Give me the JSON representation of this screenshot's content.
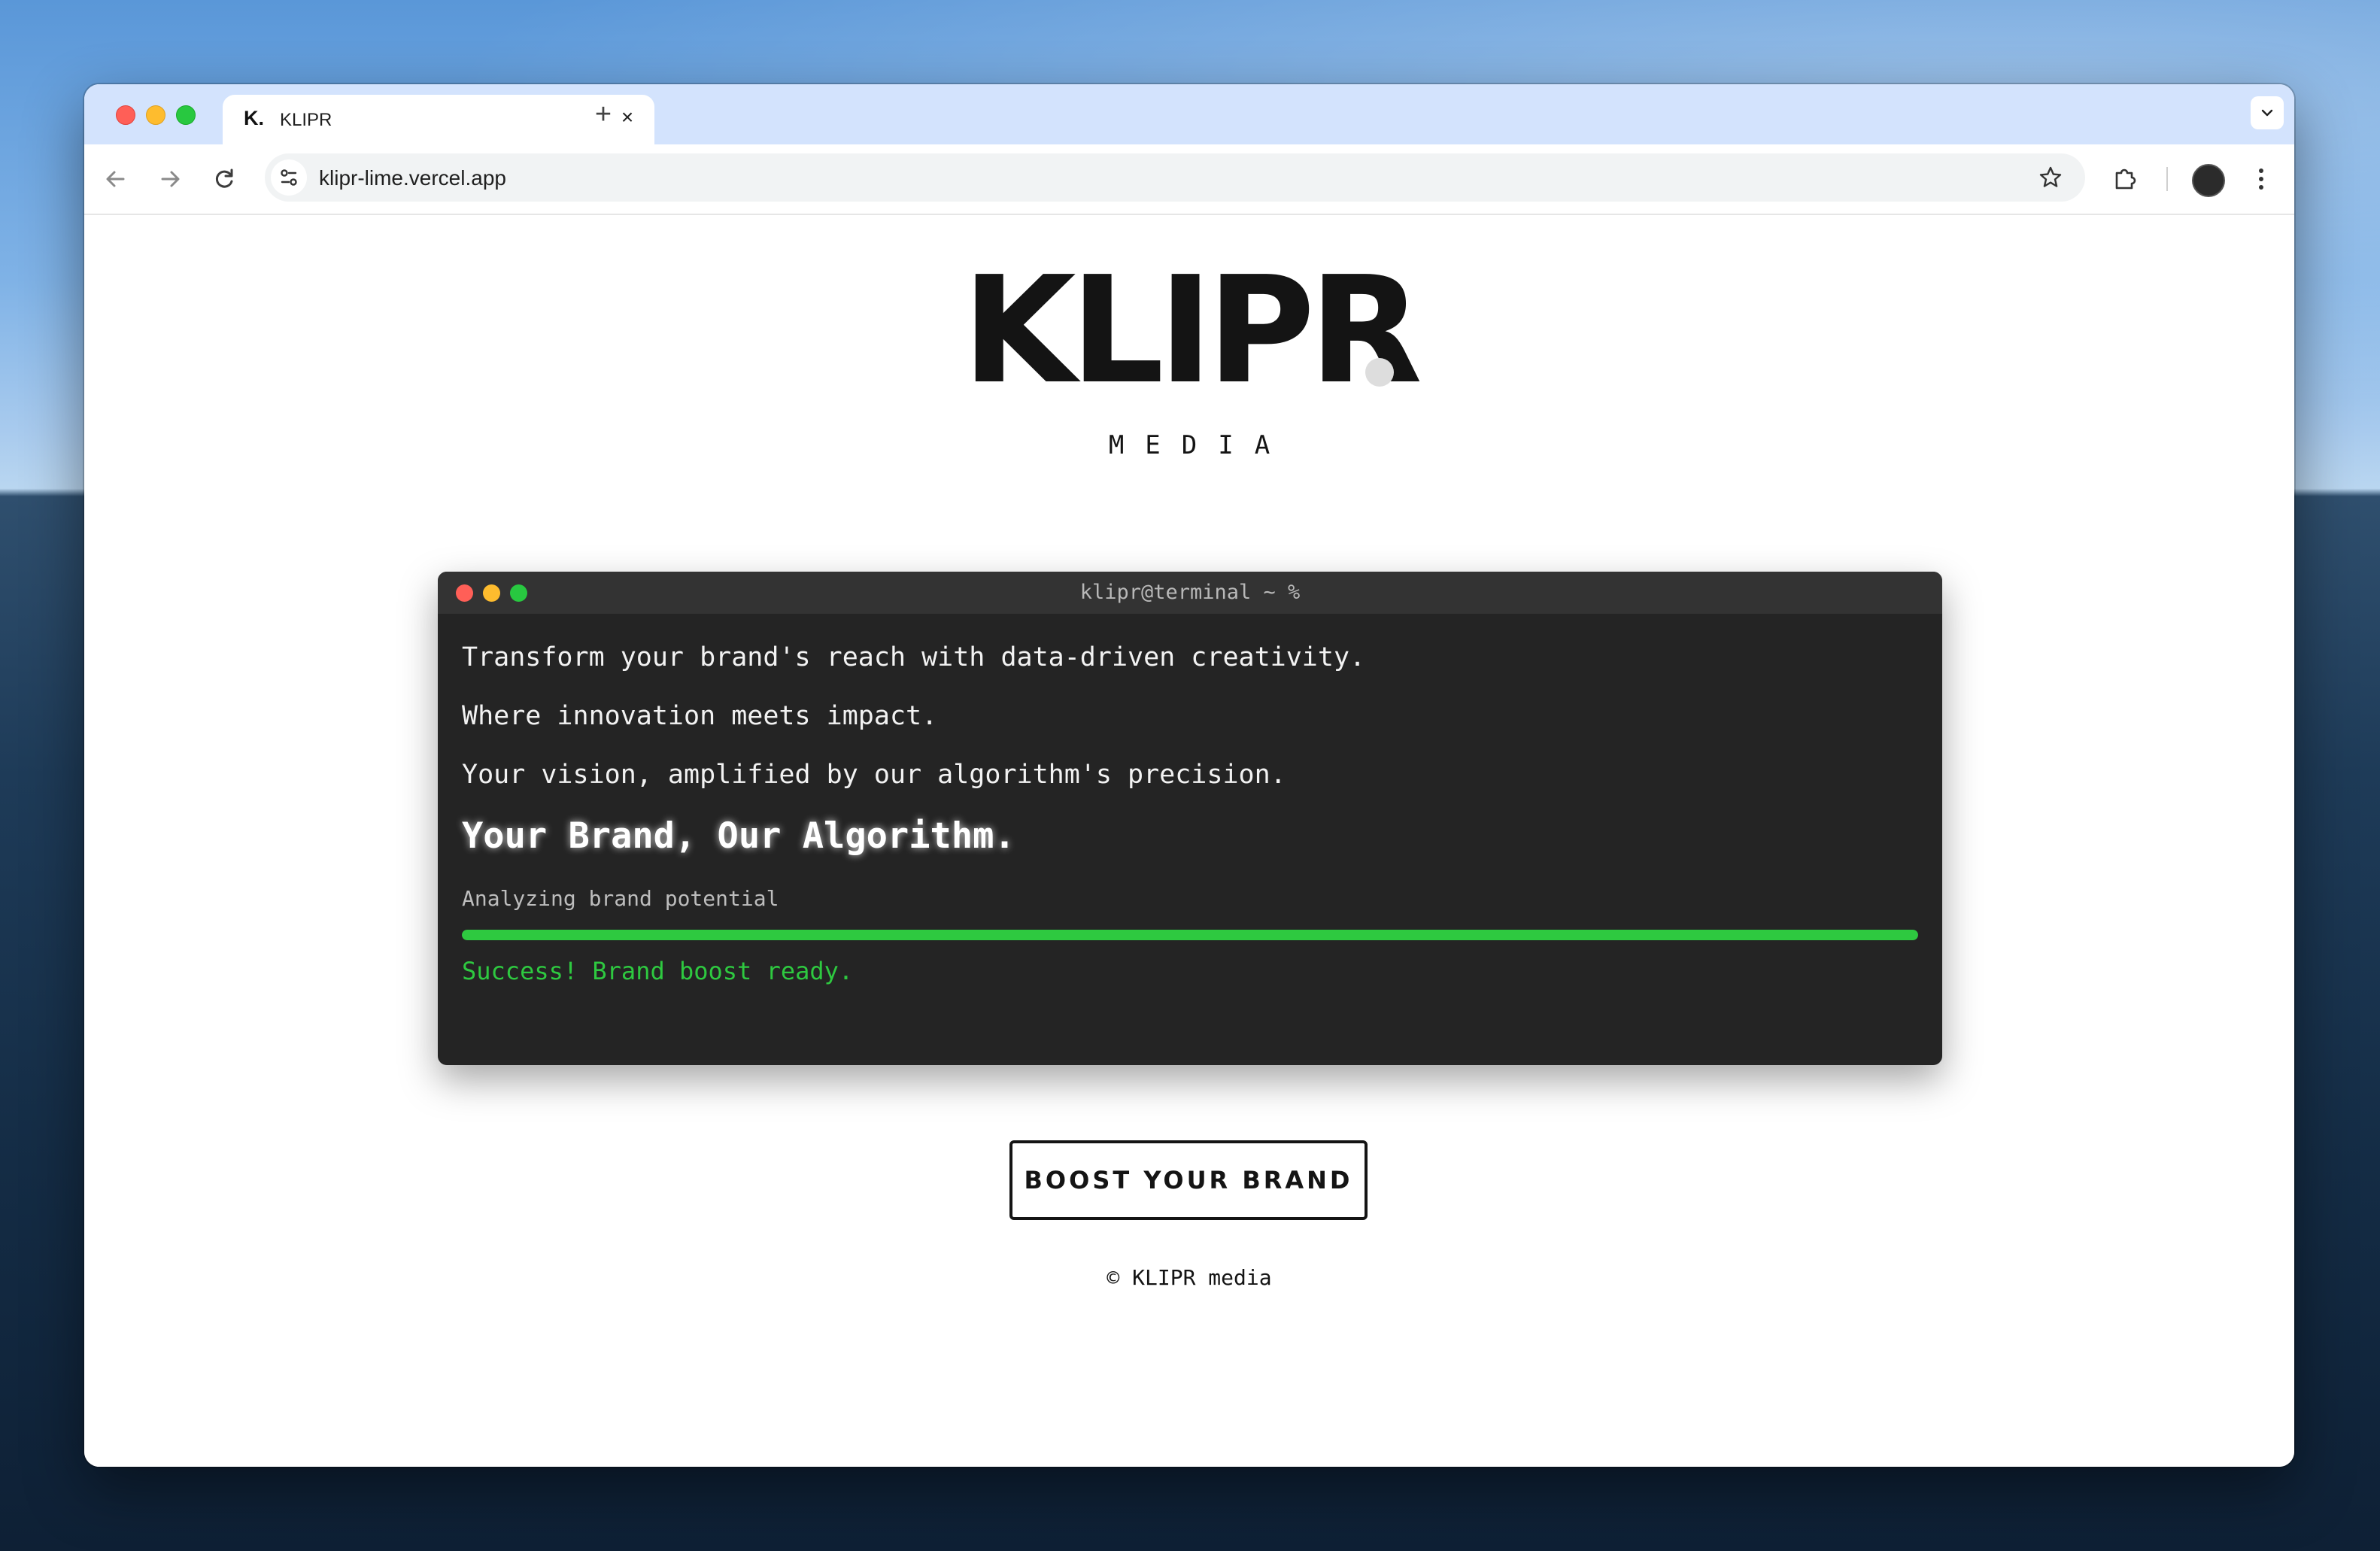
{
  "browser": {
    "tab": {
      "favicon": "K.",
      "title": "KLIPR",
      "close": "×"
    },
    "new_tab": "+",
    "url": "klipr-lime.vercel.app"
  },
  "page": {
    "logo": "KLIPR",
    "logo_subtitle": "MEDIA",
    "terminal": {
      "title": "klipr@terminal ~ %",
      "lines": [
        "Transform your brand's reach with data-driven creativity.",
        "Where innovation meets impact.",
        "Your vision, amplified by our algorithm's precision."
      ],
      "headline": "Your Brand, Our Algorithm.",
      "status": "Analyzing brand potential",
      "progress_percent": 100,
      "success": "Success! Brand boost ready."
    },
    "cta": "BOOST YOUR BRAND",
    "footer": "© KLIPR media"
  },
  "colors": {
    "accent_green": "#2ec940",
    "terminal_bg": "#242424",
    "text_dark": "#141414"
  }
}
